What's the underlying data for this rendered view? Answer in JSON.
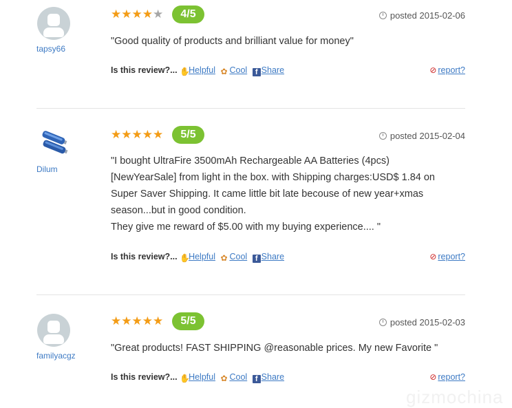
{
  "colors": {
    "accent_green": "#7cc232",
    "star": "#f39c16",
    "link": "#3d7ac4"
  },
  "reviews": [
    {
      "username": "tapsy66",
      "avatar": "default-user-avatar",
      "stars": 4,
      "score_label": "4/5",
      "posted": "posted 2015-02-06",
      "lines": [
        "\"Good quality of products and brilliant value for money\""
      ],
      "actions": {
        "question": "Is this review?...",
        "helpful": "Helpful",
        "cool": "Cool",
        "share": "Share",
        "report": "report?"
      }
    },
    {
      "username": "Dilum",
      "avatar": "battery-photo-avatar",
      "stars": 5,
      "score_label": "5/5",
      "posted": "posted 2015-02-04",
      "lines": [
        "\"I bought UltraFire 3500mAh Rechargeable AA Batteries (4pcs)",
        "[NewYearSale] from light in the box. with Shipping charges:USD$ 1.84 on",
        "Super Saver Shipping. It came little bit late becouse of new year+xmas",
        "season...but in good condition.",
        "They give me reward of $5.00 with my buying experience.... \""
      ],
      "actions": {
        "question": "Is this review?...",
        "helpful": "Helpful",
        "cool": "Cool",
        "share": "Share",
        "report": "report?"
      }
    },
    {
      "username": "familyacgz",
      "avatar": "default-user-avatar",
      "stars": 5,
      "score_label": "5/5",
      "posted": "posted 2015-02-03",
      "lines": [
        "\"Great products! FAST SHIPPING @reasonable prices. My new Favorite \""
      ],
      "actions": {
        "question": "Is this review?...",
        "helpful": "Helpful",
        "cool": "Cool",
        "share": "Share",
        "report": "report?"
      }
    }
  ],
  "watermark": "gizmochina"
}
